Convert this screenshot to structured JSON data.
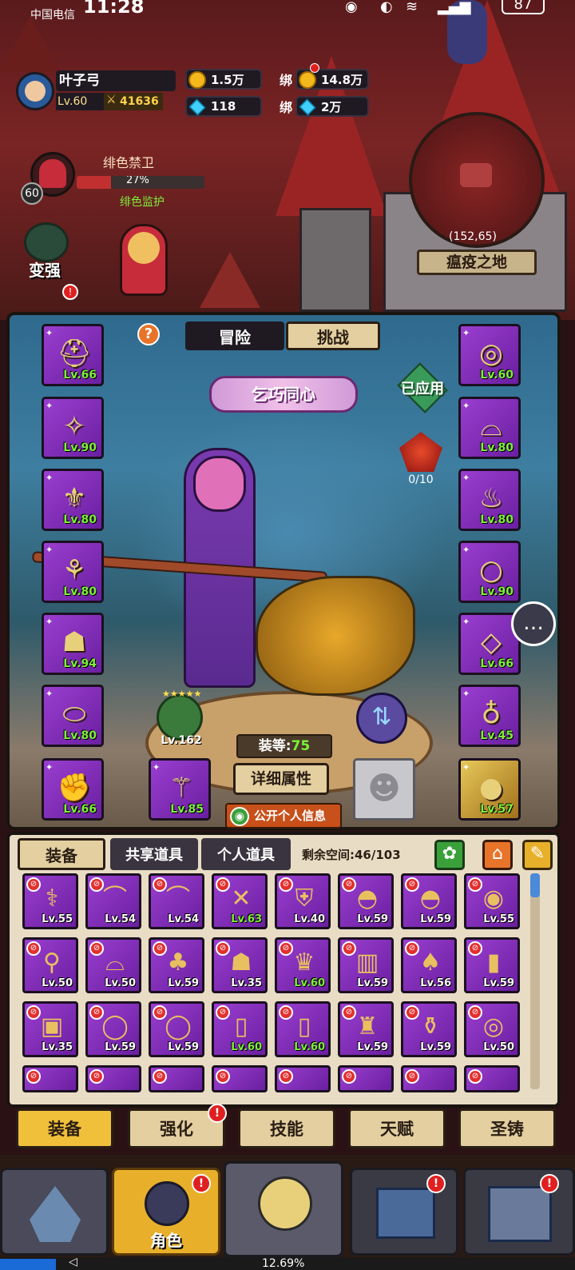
{
  "status_bar": {
    "carrier": "中国电信",
    "time": "11:28",
    "battery": "87"
  },
  "player": {
    "name": "叶子弓",
    "level": "Lv.60",
    "power": "41636"
  },
  "currency": {
    "gold": "1.5万",
    "bound_gold_label": "绑",
    "bound_gold": "14.8万",
    "gems": "118",
    "bound_gems_label": "绑",
    "bound_gems": "2万"
  },
  "target": {
    "name": "绯色禁卫",
    "percent": "27%",
    "sub": "绯色监护",
    "level": "60"
  },
  "side": {
    "strengthen": "变强"
  },
  "map": {
    "coords": "(152,65)",
    "zone": "瘟疫之地"
  },
  "mode_tabs": {
    "adventure": "冒险",
    "challenge": "挑战"
  },
  "help": "?",
  "outfit": {
    "title": "乞巧同心",
    "applied": "已应用",
    "progress": "0/10"
  },
  "left_slots": [
    "Lv.66",
    "Lv.90",
    "Lv.80",
    "Lv.80",
    "Lv.94",
    "Lv.80",
    "Lv.66"
  ],
  "right_slots": [
    "Lv.60",
    "Lv.80",
    "Lv.80",
    "Lv.90",
    "Lv.66",
    "Lv.45",
    "Lv.57"
  ],
  "armor": {
    "level": "Lv.162"
  },
  "weapon": {
    "level": "Lv.85"
  },
  "equip_level": {
    "label": "装等:",
    "value": "75"
  },
  "details_button": "详细属性",
  "public_info": "公开个人信息",
  "inv_tabs": {
    "equipment": "装备",
    "shared": "共享道具",
    "personal": "个人道具"
  },
  "space": {
    "label": "剩余空间:",
    "value": "46/103"
  },
  "inventory": [
    [
      "Lv.55",
      "Lv.54",
      "Lv.54",
      "Lv.63",
      "Lv.40",
      "Lv.59",
      "Lv.59",
      "Lv.55"
    ],
    [
      "Lv.50",
      "Lv.50",
      "Lv.59",
      "Lv.35",
      "Lv.60",
      "Lv.59",
      "Lv.56",
      "Lv.59"
    ],
    [
      "Lv.35",
      "Lv.59",
      "Lv.59",
      "Lv.60",
      "Lv.60",
      "Lv.59",
      "Lv.59",
      "Lv.50"
    ]
  ],
  "sub_tabs": [
    "装备",
    "强化",
    "技能",
    "天赋",
    "圣铸"
  ],
  "nav": {
    "role": "角色"
  },
  "bottom": {
    "progress": "12.69%"
  },
  "colors": {
    "epic": "#8a32c0",
    "accent_green": "#7ef03a",
    "panel_tan": "#e9dcc4",
    "alert": "#e02020"
  }
}
